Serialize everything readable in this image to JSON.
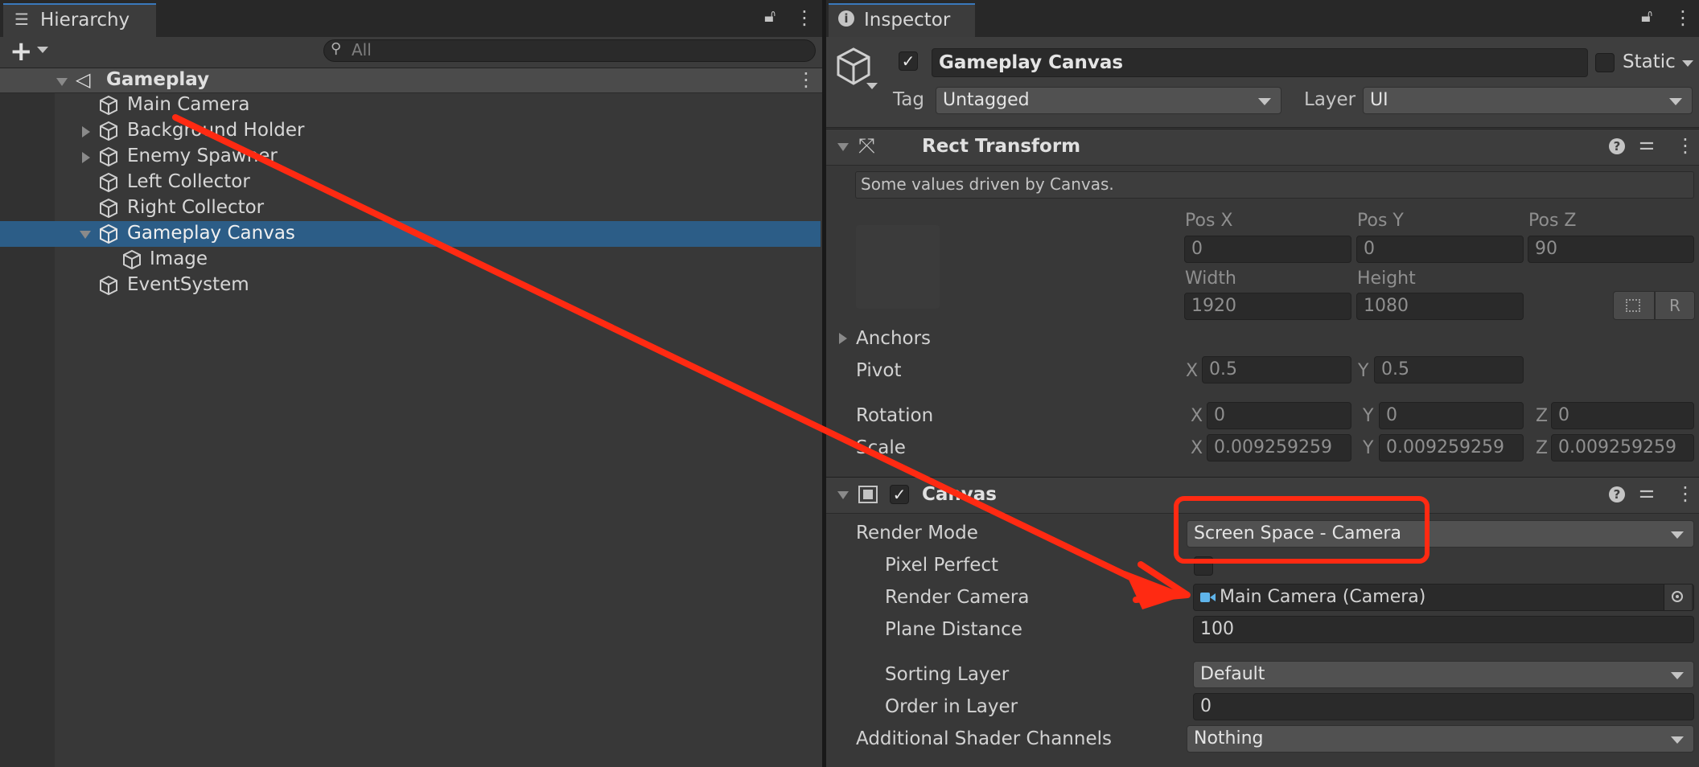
{
  "hierarchy": {
    "tab_label": "Hierarchy",
    "search_placeholder": "All",
    "scene_name": "Gameplay",
    "items": [
      {
        "label": "Main Camera"
      },
      {
        "label": "Background Holder"
      },
      {
        "label": "Enemy Spawner"
      },
      {
        "label": "Left Collector"
      },
      {
        "label": "Right Collector"
      },
      {
        "label": "Gameplay Canvas"
      },
      {
        "label": "Image"
      },
      {
        "label": "EventSystem"
      }
    ]
  },
  "inspector": {
    "tab_label": "Inspector",
    "object_name": "Gameplay Canvas",
    "static_label": "Static",
    "tag_label": "Tag",
    "tag_value": "Untagged",
    "layer_label": "Layer",
    "layer_value": "UI",
    "rect_transform": {
      "title": "Rect Transform",
      "info": "Some values driven by Canvas.",
      "pos_x_label": "Pos X",
      "pos_x": "0",
      "pos_y_label": "Pos Y",
      "pos_y": "0",
      "pos_z_label": "Pos Z",
      "pos_z": "90",
      "width_label": "Width",
      "width": "1920",
      "height_label": "Height",
      "height": "1080",
      "r_button": "R",
      "anchors_label": "Anchors",
      "pivot_label": "Pivot",
      "pivot_x": "0.5",
      "pivot_y": "0.5",
      "rotation_label": "Rotation",
      "rot_x": "0",
      "rot_y": "0",
      "rot_z": "0",
      "scale_label": "Scale",
      "scale_x": "0.009259259",
      "scale_y": "0.009259259",
      "scale_z": "0.009259259",
      "x": "X",
      "y": "Y",
      "z": "Z"
    },
    "canvas": {
      "title": "Canvas",
      "render_mode_label": "Render Mode",
      "render_mode_value": "Screen Space - Camera",
      "pixel_perfect_label": "Pixel Perfect",
      "render_camera_label": "Render Camera",
      "render_camera_value": "Main Camera (Camera)",
      "plane_distance_label": "Plane Distance",
      "plane_distance_value": "100",
      "sorting_layer_label": "Sorting Layer",
      "sorting_layer_value": "Default",
      "order_in_layer_label": "Order in Layer",
      "order_in_layer_value": "0",
      "shader_channels_label": "Additional Shader Channels",
      "shader_channels_value": "Nothing"
    }
  },
  "colors": {
    "selection": "#2c5d87",
    "annotation": "#ff2a12",
    "camera_icon": "#5fb4ea"
  }
}
